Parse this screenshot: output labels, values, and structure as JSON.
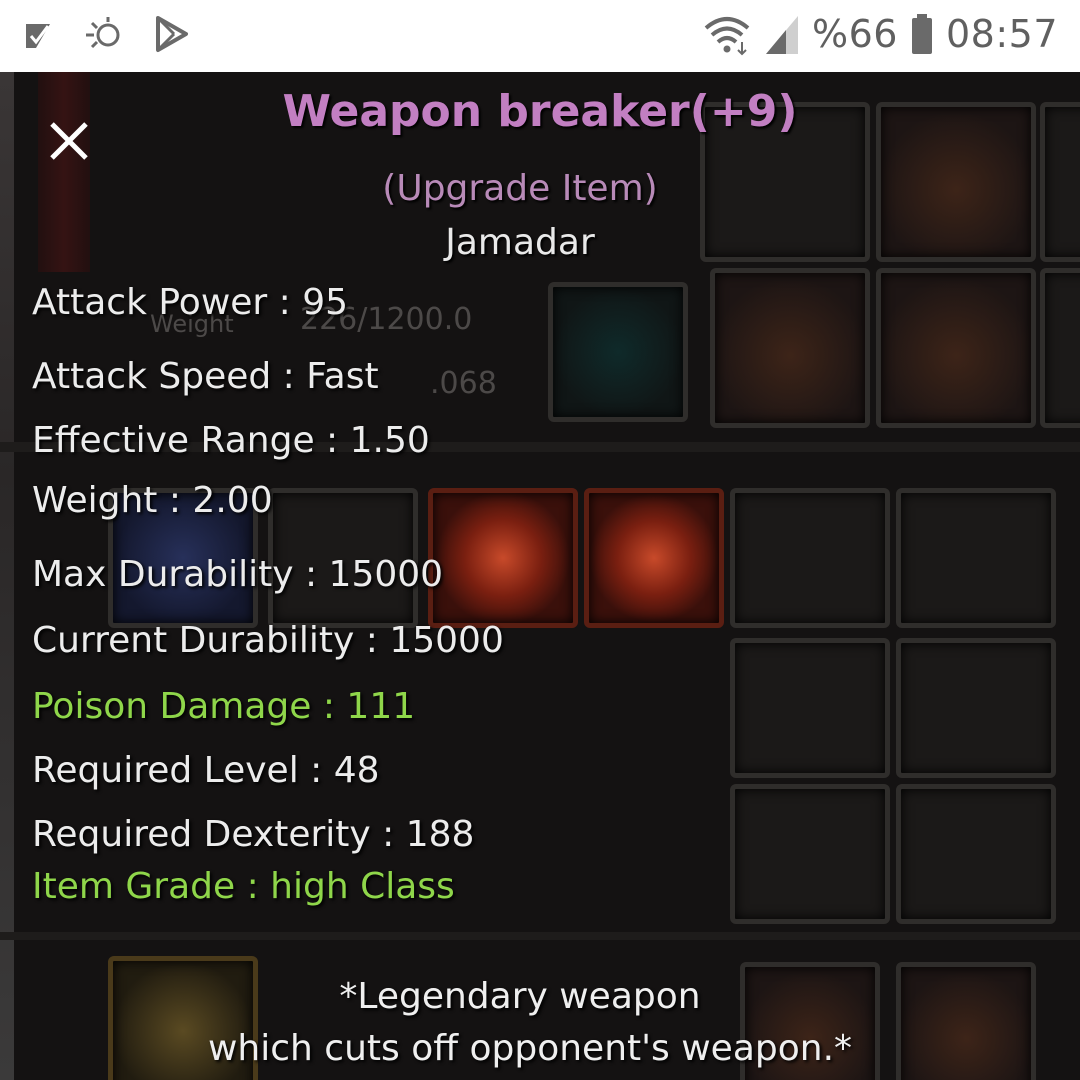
{
  "status_bar": {
    "left_icons": [
      "check-mark-icon",
      "sync-icon",
      "play-store-icon"
    ],
    "wifi_icon": "wifi-icon",
    "signal_icon": "signal-icon",
    "battery_text": "%66",
    "battery_icon": "battery-icon",
    "time": "08:57"
  },
  "background_game": {
    "ghost_text_1": "226/1200.0",
    "ghost_text_2": ".068",
    "ghost_text_3": "Weight"
  },
  "tooltip": {
    "close_icon": "close-icon",
    "title": "Weapon breaker(+9)",
    "subtitle": "(Upgrade Item)",
    "item_type": "Jamadar",
    "stats": [
      {
        "label": "Attack Power : 95",
        "color": "#ececec"
      },
      {
        "label": "Attack Speed : Fast",
        "color": "#ececec"
      },
      {
        "label": "Effective Range : 1.50",
        "color": "#ececec"
      },
      {
        "label": "Weight : 2.00",
        "color": "#ececec"
      },
      {
        "label": "Max Durability : 15000",
        "color": "#ececec"
      },
      {
        "label": "Current Durability : 15000",
        "color": "#ececec"
      },
      {
        "label": "Poison Damage : 111",
        "color": "#8fd64a"
      },
      {
        "label": "Required Level : 48",
        "color": "#ececec"
      },
      {
        "label": "Required Dexterity : 188",
        "color": "#ececec"
      },
      {
        "label": "Item Grade : high Class",
        "color": "#8fd64a"
      }
    ],
    "description_line_1": "*Legendary weapon",
    "description_line_2": "which cuts off opponent's weapon.*"
  },
  "colors": {
    "title": "#c27fc2",
    "subtitle": "#b88ab8",
    "stat_text": "#ececec",
    "special_stat": "#8fd64a",
    "status_bar_bg": "#ffffff"
  }
}
